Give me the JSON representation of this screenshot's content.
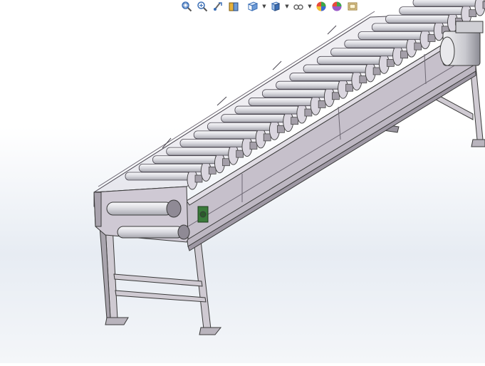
{
  "app": {
    "title": ""
  },
  "toolbar": {
    "buttons": [
      {
        "id": "zoom-to-fit",
        "icon": "zoom-to-fit-icon"
      },
      {
        "id": "zoom-to-area",
        "icon": "zoom-to-area-icon"
      },
      {
        "id": "previous-view",
        "icon": "previous-view-icon"
      },
      {
        "id": "section-view",
        "icon": "section-view-icon"
      },
      {
        "id": "view-orientation",
        "icon": "view-orientation-icon",
        "dropdown": true
      },
      {
        "id": "display-style",
        "icon": "display-style-icon",
        "dropdown": true
      },
      {
        "id": "hide-show-items",
        "icon": "hide-show-items-icon",
        "dropdown": true
      },
      {
        "id": "edit-appearance",
        "icon": "edit-appearance-icon"
      },
      {
        "id": "apply-scene",
        "icon": "apply-scene-icon"
      },
      {
        "id": "view-settings",
        "icon": "view-settings-icon"
      }
    ]
  },
  "colors": {
    "frame": "#c9c3cd",
    "frame_edge": "#3a3a3a",
    "guard_fill": "#dedbe4",
    "roller": "#e6e6ea",
    "motor": "#d8d8dc",
    "accent_green": "#3a7a3a",
    "toolbar_blue": "#3b6fb6"
  },
  "model": {
    "conveyor_roller_count": 22
  }
}
